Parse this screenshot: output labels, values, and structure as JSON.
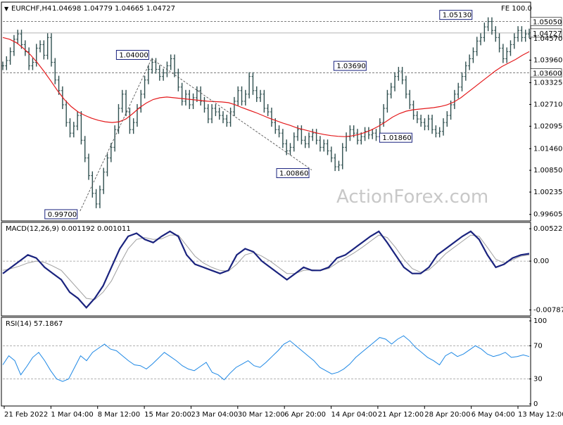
{
  "header": {
    "symbol": "EURCHF,H4",
    "ohlc": "1.04698 1.04779 1.04665 1.04727",
    "fe_label": "FE 100.0"
  },
  "watermark": "ActionForex.com",
  "colors": {
    "candle": "#2f4f4f",
    "ma": "#e41a1c",
    "macd": "#1a237e",
    "signal": "#a0a0a0",
    "rsi": "#1e88e5",
    "dash": "#555555",
    "label_border": "#1a237e",
    "label_fill": "#ffffff"
  },
  "chart_data": [
    {
      "type": "line",
      "panel": "price",
      "ylim": [
        0.995,
        1.055
      ],
      "y_ticks": [
        "1.04570",
        "1.03960",
        "1.03325",
        "1.02710",
        "1.02095",
        "1.01460",
        "1.00850",
        "1.00235",
        "0.99605"
      ],
      "x_tick_labels": [
        "21 Feb 2022",
        "1 Mar 04:00",
        "8 Mar 12:00",
        "15 Mar 20:00",
        "23 Mar 04:00",
        "30 Mar 12:00",
        "6 Apr 20:00",
        "14 Apr 04:00",
        "21 Apr 12:00",
        "28 Apr 20:00",
        "6 May 04:00",
        "13 May 12:00"
      ],
      "series": [
        {
          "kind": "close",
          "values": [
            1.038,
            1.0395,
            1.042,
            1.0455,
            1.047,
            1.044,
            1.042,
            1.038,
            1.039,
            1.043,
            1.044,
            1.041,
            1.046,
            1.039,
            1.034,
            1.031,
            1.027,
            1.022,
            1.019,
            1.021,
            1.024,
            1.017,
            1.012,
            1.007,
            1.002,
            0.999,
            1.003,
            1.008,
            1.012,
            1.015,
            1.02,
            1.026,
            1.03,
            1.025,
            1.02,
            1.022,
            1.026,
            1.03,
            1.034,
            1.037,
            1.039,
            1.037,
            1.035,
            1.036,
            1.038,
            1.04,
            1.036,
            1.032,
            1.028,
            1.03,
            1.027,
            1.029,
            1.031,
            1.028,
            1.026,
            1.023,
            1.026,
            1.025,
            1.024,
            1.023,
            1.022,
            1.025,
            1.028,
            1.031,
            1.028,
            1.03,
            1.035,
            1.031,
            1.029,
            1.03,
            1.026,
            1.025,
            1.022,
            1.02,
            1.019,
            1.016,
            1.014,
            1.015,
            1.018,
            1.02,
            1.017,
            1.016,
            1.018,
            1.019,
            1.017,
            1.015,
            1.016,
            1.014,
            1.012,
            1.0095,
            1.01,
            1.015,
            1.018,
            1.02,
            1.019,
            1.017,
            1.018,
            1.0195,
            1.0185,
            1.019,
            1.018,
            1.022,
            1.026,
            1.03,
            1.032,
            1.035,
            1.0365,
            1.034,
            1.03,
            1.027,
            1.024,
            1.023,
            1.022,
            1.021,
            1.023,
            1.02,
            1.019,
            1.0195,
            1.022,
            1.024,
            1.027,
            1.03,
            1.032,
            1.035,
            1.038,
            1.04,
            1.042,
            1.045,
            1.046,
            1.049,
            1.0505,
            1.048,
            1.046,
            1.043,
            1.04,
            1.042,
            1.044,
            1.046,
            1.048,
            1.046,
            1.047,
            1.0473
          ]
        },
        {
          "kind": "moving-average",
          "values": [
            1.046,
            1.0455,
            1.0445,
            1.043,
            1.0412,
            1.039,
            1.0365,
            1.0338,
            1.031,
            1.0285,
            1.0265,
            1.025,
            1.024,
            1.0232,
            1.0226,
            1.0222,
            1.022,
            1.0222,
            1.023,
            1.0245,
            1.0262,
            1.0275,
            1.0285,
            1.029,
            1.0292,
            1.029,
            1.0288,
            1.0286,
            1.0284,
            1.0282,
            1.028,
            1.0279,
            1.0278,
            1.0276,
            1.027,
            1.0262,
            1.0255,
            1.0248,
            1.024,
            1.0232,
            1.0225,
            1.0218,
            1.0212,
            1.0205,
            1.02,
            1.0195,
            1.019,
            1.0186,
            1.0183,
            1.0181,
            1.018,
            1.0182,
            1.0186,
            1.0192,
            1.02,
            1.021,
            1.0222,
            1.0235,
            1.0245,
            1.0252,
            1.0256,
            1.0258,
            1.026,
            1.0262,
            1.0265,
            1.027,
            1.0278,
            1.029,
            1.0305,
            1.032,
            1.0335,
            1.035,
            1.0365,
            1.0378,
            1.0388,
            1.0398,
            1.041,
            1.042
          ]
        }
      ],
      "annotations": [
        {
          "text": "0.99700",
          "x_index": 27,
          "value": 0.997
        },
        {
          "text": "1.04000",
          "x_index": 52,
          "value": 1.04
        },
        {
          "text": "1.00860",
          "x_index": 108,
          "value": 1.0086
        },
        {
          "text": "1.03690",
          "x_index": 128,
          "value": 1.0369
        },
        {
          "text": "1.01860",
          "x_index": 144,
          "value": 1.0186
        },
        {
          "text": "1.05130",
          "x_index": 165,
          "value": 1.0513
        }
      ],
      "horizontal_levels": [
        {
          "value": 1.0505,
          "label": "1.05050",
          "style": "dashed"
        },
        {
          "value": 1.036,
          "label": "1.03600",
          "style": "dashed"
        },
        {
          "value": 1.04727,
          "label": "1.04727",
          "style": "solid"
        }
      ]
    },
    {
      "type": "line",
      "panel": "macd",
      "title": "MACD(12,26,9) 0.001192 0.001011",
      "ylim": [
        -0.0085,
        0.0058
      ],
      "y_ticks": [
        "0.005226",
        "0.00",
        "-0.007873"
      ],
      "series": [
        {
          "kind": "macd",
          "values": [
            -0.002,
            -0.001,
            0.0,
            0.001,
            0.0005,
            -0.001,
            -0.002,
            -0.003,
            -0.005,
            -0.006,
            -0.0075,
            -0.006,
            -0.004,
            -0.001,
            0.002,
            0.004,
            0.0045,
            0.0035,
            0.003,
            0.004,
            0.0048,
            0.004,
            0.001,
            -0.0005,
            -0.001,
            -0.0015,
            -0.002,
            -0.0015,
            0.001,
            0.002,
            0.0015,
            0.0,
            -0.001,
            -0.002,
            -0.003,
            -0.002,
            -0.001,
            -0.0015,
            -0.0015,
            -0.001,
            0.0005,
            0.001,
            0.002,
            0.003,
            0.004,
            0.0048,
            0.003,
            0.001,
            -0.001,
            -0.002,
            -0.002,
            -0.001,
            0.001,
            0.002,
            0.003,
            0.004,
            0.0048,
            0.0035,
            0.001,
            -0.001,
            -0.0005,
            0.0005,
            0.001,
            0.0012
          ]
        },
        {
          "kind": "signal",
          "values": [
            -0.0015,
            -0.0012,
            -0.0008,
            -0.0003,
            0.0,
            -0.0002,
            -0.0008,
            -0.0015,
            -0.003,
            -0.0045,
            -0.006,
            -0.0062,
            -0.005,
            -0.0032,
            -0.0005,
            0.002,
            0.0035,
            0.0038,
            0.0035,
            0.0036,
            0.0042,
            0.0042,
            0.0025,
            0.0008,
            -0.0003,
            -0.001,
            -0.0015,
            -0.0016,
            -0.0005,
            0.001,
            0.0014,
            0.0008,
            0.0,
            -0.001,
            -0.002,
            -0.002,
            -0.0015,
            -0.0014,
            -0.0015,
            -0.0012,
            -0.0003,
            0.0005,
            0.0013,
            0.0022,
            0.0032,
            0.0042,
            0.0038,
            0.0022,
            0.0003,
            -0.0012,
            -0.0018,
            -0.0014,
            -0.0002,
            0.0012,
            0.0022,
            0.0032,
            0.0042,
            0.004,
            0.0022,
            0.0003,
            -0.0003,
            0.0002,
            0.0008,
            0.001
          ]
        }
      ]
    },
    {
      "type": "line",
      "panel": "rsi",
      "title": "RSI(14) 57.1867",
      "ylim": [
        0,
        100
      ],
      "y_ticks": [
        "100",
        "70",
        "30",
        "0"
      ],
      "levels": [
        70,
        30
      ],
      "series": [
        {
          "kind": "rsi",
          "values": [
            47,
            58,
            52,
            35,
            45,
            56,
            62,
            52,
            40,
            30,
            27,
            30,
            44,
            58,
            52,
            62,
            67,
            72,
            66,
            64,
            58,
            52,
            47,
            46,
            42,
            48,
            55,
            62,
            57,
            52,
            46,
            42,
            40,
            45,
            50,
            38,
            35,
            29,
            37,
            44,
            48,
            52,
            46,
            44,
            50,
            57,
            64,
            72,
            76,
            70,
            64,
            58,
            52,
            44,
            40,
            36,
            38,
            42,
            48,
            56,
            62,
            68,
            74,
            80,
            78,
            72,
            78,
            82,
            76,
            68,
            62,
            56,
            52,
            47,
            58,
            62,
            57,
            60,
            65,
            70,
            66,
            60,
            57,
            59,
            62,
            56,
            57,
            59,
            57
          ]
        }
      ]
    }
  ]
}
